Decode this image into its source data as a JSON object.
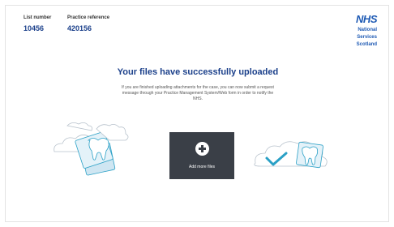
{
  "header": {
    "list_number_label": "List number",
    "list_number_value": "10456",
    "practice_reference_label": "Practice reference",
    "practice_reference_value": "420156"
  },
  "logo": {
    "name": "NHS",
    "line1": "National",
    "line2": "Services",
    "line3": "Scotland"
  },
  "main": {
    "title": "Your files have successfully uploaded",
    "message": "If you are finished uploading attachments for the case, you can now submit a request message through your Practice Management System/Web form in order to notify the NHS."
  },
  "actions": {
    "add_more_files_label": "Add more files",
    "add_more_files_icon": "plus-circle-icon"
  },
  "colors": {
    "brand_blue": "#1e5ab4",
    "heading_blue": "#1a3f8a",
    "button_bg": "#3a3f47",
    "illustration_teal": "#2aa0c6",
    "illustration_light": "#cfe6f2"
  }
}
